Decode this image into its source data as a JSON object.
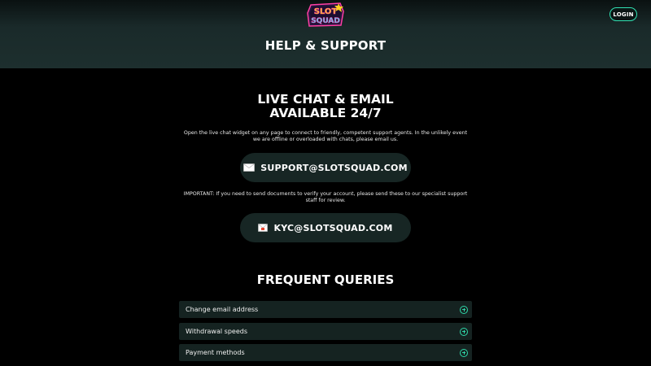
{
  "header": {
    "logo": {
      "line1": "SLOT",
      "line2": "SQUAD"
    },
    "login_label": "LOGIN",
    "page_title": "HELP & SUPPORT"
  },
  "live": {
    "title_line1": "LIVE CHAT & EMAIL",
    "title_line2": "AVAILABLE 24/7",
    "description": "Open the live chat widget on any page to connect to friendly, competent support agents. In the unlikely event we are offline or overloaded with chats, please email us.",
    "support_email": "SUPPORT@SLOTSQUAD.COM",
    "support_icon": "envelope-icon",
    "important": "IMPORTANT: If you need to send documents to verify your account, please send these to our specialist support staff for review.",
    "kyc_email": "KYC@SLOTSQUAD.COM",
    "kyc_icon": "envelope-icon"
  },
  "faq": {
    "title": "FREQUENT QUERIES",
    "items": [
      {
        "label": "Change email address",
        "icon": "plus-circle-icon"
      },
      {
        "label": "Withdrawal speeds",
        "icon": "plus-circle-icon"
      },
      {
        "label": "Payment methods",
        "icon": "plus-circle-icon"
      }
    ]
  },
  "colors": {
    "accent": "#31e3b4",
    "background": "#000000",
    "panel": "#172624",
    "logo_pink": "#ff3fa4",
    "logo_yellow": "#ffd21f",
    "logo_cyan": "#3ee6ff"
  }
}
